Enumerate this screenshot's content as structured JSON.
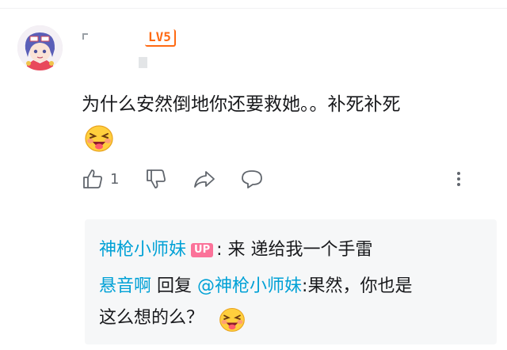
{
  "comment": {
    "level_badge": "LV5",
    "text": "为什么安然倒地你还要救她。。补死补死",
    "emoji_icon": "laughing-tongue-emoji",
    "like_count": "1"
  },
  "actions": {
    "like_icon": "thumbs-up-icon",
    "dislike_icon": "thumbs-down-icon",
    "share_icon": "share-icon",
    "comment_icon": "comment-icon",
    "more_icon": "more-vertical-icon"
  },
  "replies": [
    {
      "username": "神枪小师妹",
      "badge": "UP",
      "text": ": 来 递给我一个手雷"
    },
    {
      "username": "悬音啊",
      "reply_word": "回复",
      "mention": "@神枪小师妹",
      "text_line1": ":果然，你也是",
      "text_line2": "这么想的么？",
      "emoji_icon": "laughing-tongue-emoji"
    }
  ],
  "colors": {
    "link_blue": "#00a1d6",
    "up_badge_pink": "#fb7299",
    "level_orange": "#ff6a13",
    "reply_bg": "#f6f7f8",
    "icon_gray": "#61666d"
  }
}
